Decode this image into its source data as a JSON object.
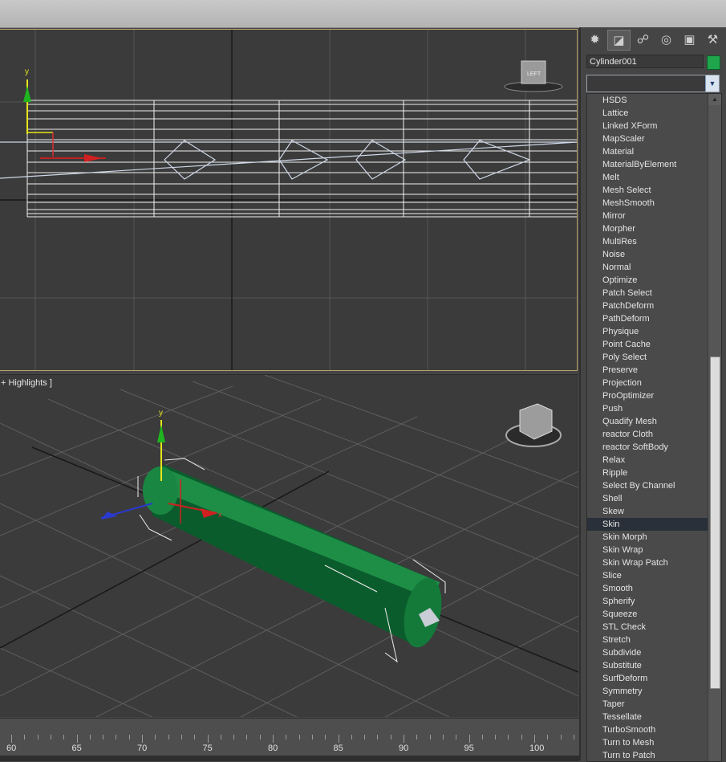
{
  "viewports": {
    "left": {
      "view_cube_label": "LEFT",
      "axis_y": "y"
    },
    "perspective": {
      "label": "+ Highlights ]",
      "axis_y": "y",
      "axis_x": "x"
    }
  },
  "timeline": {
    "ticks": [
      "60",
      "65",
      "70",
      "75",
      "80",
      "85",
      "90",
      "95",
      "100"
    ]
  },
  "command_panel": {
    "tabs": [
      {
        "icon": "sun-create-icon"
      },
      {
        "icon": "modify-curve-icon"
      },
      {
        "icon": "hierarchy-icon"
      },
      {
        "icon": "motion-icon"
      },
      {
        "icon": "display-monitor-icon"
      },
      {
        "icon": "utilities-hammer-icon"
      }
    ],
    "object_name": "Cylinder001",
    "object_color": "#1fa54c",
    "modifier_list": [
      "HSDS",
      "Lattice",
      "Linked XForm",
      "MapScaler",
      "Material",
      "MaterialByElement",
      "Melt",
      "Mesh Select",
      "MeshSmooth",
      "Mirror",
      "Morpher",
      "MultiRes",
      "Noise",
      "Normal",
      "Optimize",
      "Patch Select",
      "PatchDeform",
      "PathDeform",
      "Physique",
      "Point Cache",
      "Poly Select",
      "Preserve",
      "Projection",
      "ProOptimizer",
      "Push",
      "Quadify Mesh",
      "reactor Cloth",
      "reactor SoftBody",
      "Relax",
      "Ripple",
      "Select By Channel",
      "Shell",
      "Skew",
      "Skin",
      "Skin Morph",
      "Skin Wrap",
      "Skin Wrap Patch",
      "Slice",
      "Smooth",
      "Spherify",
      "Squeeze",
      "STL Check",
      "Stretch",
      "Subdivide",
      "Substitute",
      "SurfDeform",
      "Symmetry",
      "Taper",
      "Tessellate",
      "TurboSmooth",
      "Turn to Mesh",
      "Turn to Patch"
    ],
    "selected_modifier": "Skin"
  }
}
